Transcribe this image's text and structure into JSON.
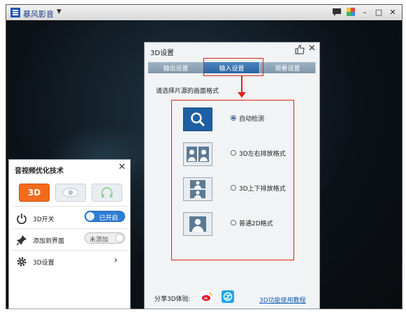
{
  "app": {
    "title": "暴风影音",
    "menu_caret": "▼"
  },
  "window_controls": {
    "minimize": "–",
    "maximize": "□",
    "close": "✕"
  },
  "left_panel": {
    "title": "音视频优化技术",
    "close": "✕",
    "modes": [
      {
        "label": "3D"
      },
      {
        "icon": "eye-icon"
      },
      {
        "icon": "headphone-icon"
      }
    ],
    "rows": [
      {
        "label": "3D开关",
        "state": "已开启"
      },
      {
        "label": "添加到界面",
        "state": "未添加"
      },
      {
        "label": "3D设置",
        "chevron": "›"
      }
    ]
  },
  "dialog": {
    "title": "3D设置",
    "close": "✕",
    "tabs": [
      {
        "label": "输出设置"
      },
      {
        "label": "输入设置"
      },
      {
        "label": "观看设置"
      }
    ],
    "active_tab": 1,
    "prompt": "请选择片源的画面格式",
    "options": [
      {
        "label": "自动检测",
        "selected": true
      },
      {
        "label": "3D左右排放格式",
        "selected": false
      },
      {
        "label": "3D上下排放格式",
        "selected": false
      },
      {
        "label": "普通2D格式",
        "selected": false
      }
    ],
    "share_label": "分享3D体验:",
    "help_link": "3D功能使用教程"
  },
  "colors": {
    "accent_orange": "#f26a1b",
    "accent_blue": "#2d64a0",
    "highlight_red": "#e0241b"
  }
}
